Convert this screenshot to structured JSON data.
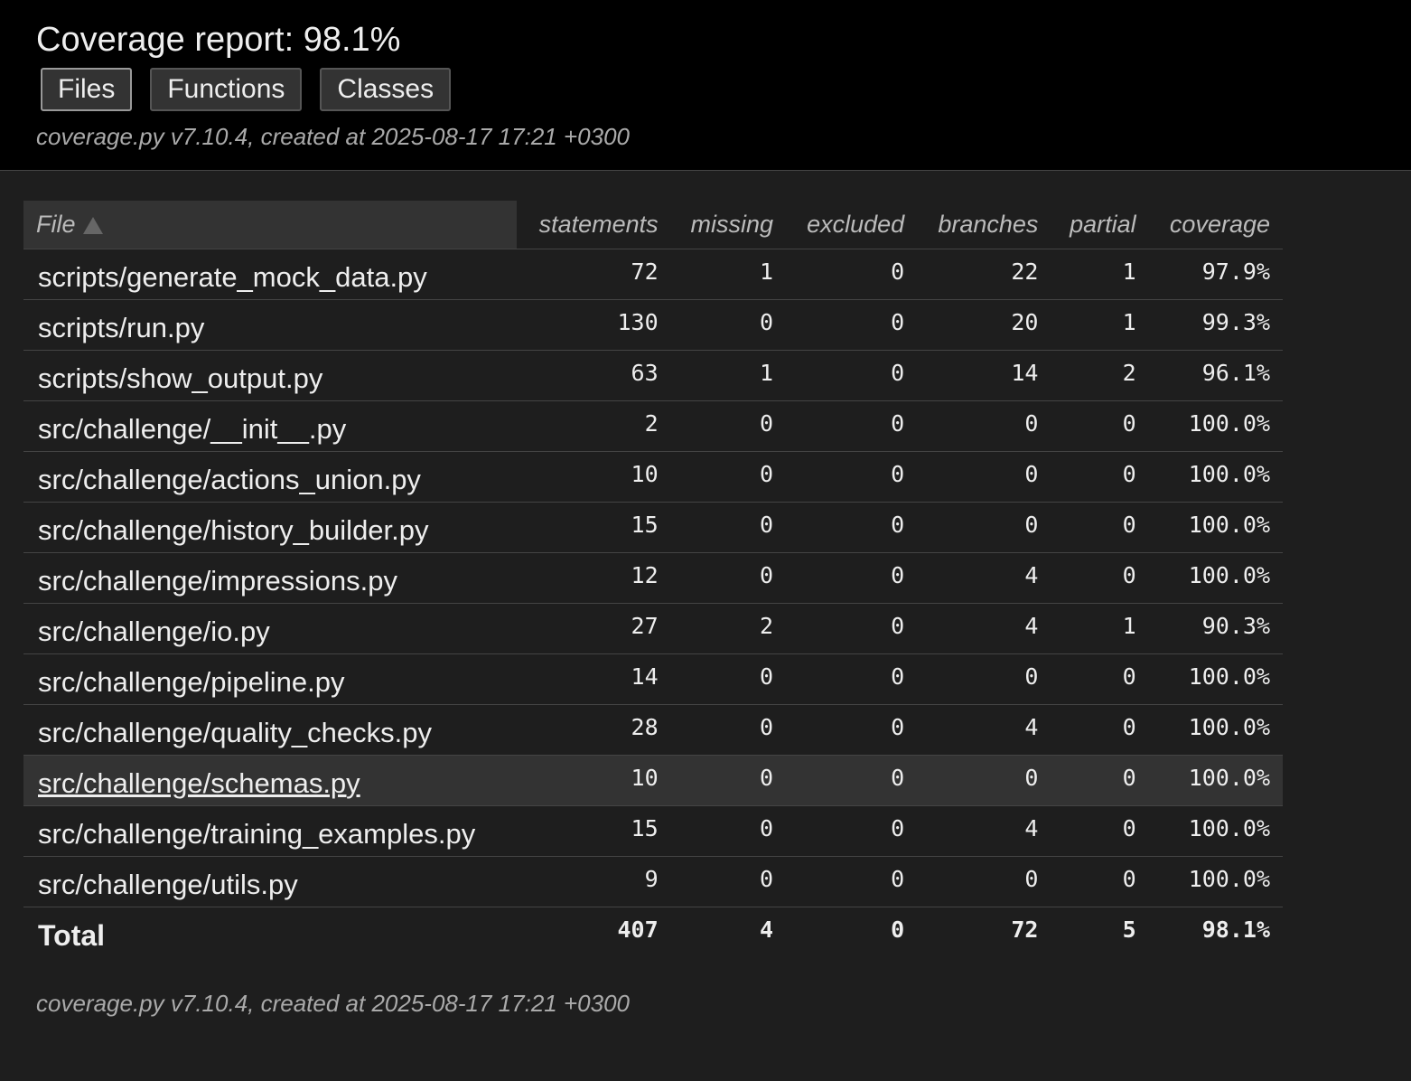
{
  "header": {
    "title": "Coverage report: 98.1%",
    "buttons": [
      "Files",
      "Functions",
      "Classes"
    ],
    "meta": "coverage.py v7.10.4, created at 2025-08-17 17:21 +0300"
  },
  "table": {
    "columns": [
      "File",
      "statements",
      "missing",
      "excluded",
      "branches",
      "partial",
      "coverage"
    ],
    "rows": [
      {
        "file": "scripts/generate_mock_data.py",
        "statements": "72",
        "missing": "1",
        "excluded": "0",
        "branches": "22",
        "partial": "1",
        "coverage": "97.9%"
      },
      {
        "file": "scripts/run.py",
        "statements": "130",
        "missing": "0",
        "excluded": "0",
        "branches": "20",
        "partial": "1",
        "coverage": "99.3%"
      },
      {
        "file": "scripts/show_output.py",
        "statements": "63",
        "missing": "1",
        "excluded": "0",
        "branches": "14",
        "partial": "2",
        "coverage": "96.1%"
      },
      {
        "file": "src/challenge/__init__.py",
        "statements": "2",
        "missing": "0",
        "excluded": "0",
        "branches": "0",
        "partial": "0",
        "coverage": "100.0%"
      },
      {
        "file": "src/challenge/actions_union.py",
        "statements": "10",
        "missing": "0",
        "excluded": "0",
        "branches": "0",
        "partial": "0",
        "coverage": "100.0%"
      },
      {
        "file": "src/challenge/history_builder.py",
        "statements": "15",
        "missing": "0",
        "excluded": "0",
        "branches": "0",
        "partial": "0",
        "coverage": "100.0%"
      },
      {
        "file": "src/challenge/impressions.py",
        "statements": "12",
        "missing": "0",
        "excluded": "0",
        "branches": "4",
        "partial": "0",
        "coverage": "100.0%"
      },
      {
        "file": "src/challenge/io.py",
        "statements": "27",
        "missing": "2",
        "excluded": "0",
        "branches": "4",
        "partial": "1",
        "coverage": "90.3%"
      },
      {
        "file": "src/challenge/pipeline.py",
        "statements": "14",
        "missing": "0",
        "excluded": "0",
        "branches": "0",
        "partial": "0",
        "coverage": "100.0%"
      },
      {
        "file": "src/challenge/quality_checks.py",
        "statements": "28",
        "missing": "0",
        "excluded": "0",
        "branches": "4",
        "partial": "0",
        "coverage": "100.0%"
      },
      {
        "file": "src/challenge/schemas.py",
        "statements": "10",
        "missing": "0",
        "excluded": "0",
        "branches": "0",
        "partial": "0",
        "coverage": "100.0%"
      },
      {
        "file": "src/challenge/training_examples.py",
        "statements": "15",
        "missing": "0",
        "excluded": "0",
        "branches": "4",
        "partial": "0",
        "coverage": "100.0%"
      },
      {
        "file": "src/challenge/utils.py",
        "statements": "9",
        "missing": "0",
        "excluded": "0",
        "branches": "0",
        "partial": "0",
        "coverage": "100.0%"
      }
    ],
    "total": {
      "file": "Total",
      "statements": "407",
      "missing": "4",
      "excluded": "0",
      "branches": "72",
      "partial": "5",
      "coverage": "98.1%"
    },
    "hovered_row": 10
  },
  "footer": {
    "meta": "coverage.py v7.10.4, created at 2025-08-17 17:21 +0300"
  },
  "icons": {
    "sort": "sort-ascending-icon"
  },
  "colors": {
    "header_bg": "#000000",
    "page_bg": "#1e1e1e",
    "row_highlight": "#333333"
  }
}
